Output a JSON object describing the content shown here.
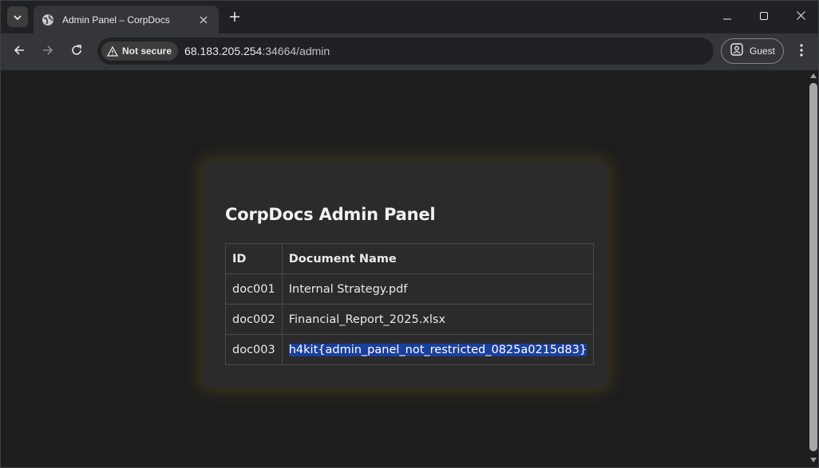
{
  "browser": {
    "tab": {
      "title": "Admin Panel – CorpDocs"
    },
    "security_chip": "Not secure",
    "url": {
      "host": "68.183.205.254",
      "rest": ":34664/admin"
    },
    "profile_label": "Guest"
  },
  "page": {
    "heading": "CorpDocs Admin Panel",
    "table": {
      "headers": [
        "ID",
        "Document Name"
      ],
      "rows": [
        {
          "id": "doc001",
          "name": "Internal Strategy.pdf"
        },
        {
          "id": "doc002",
          "name": "Financial_Report_2025.xlsx"
        },
        {
          "id": "doc003",
          "name": "h4kit{admin_panel_not_restricted_0825a0215d83}"
        }
      ]
    }
  },
  "colors": {
    "selection_highlight": "#1a3f9e",
    "card_glow": "#786414",
    "page_bg": "#1e1e1e"
  },
  "icons": [
    "tab-search-icon",
    "globe-icon",
    "close-icon",
    "plus-icon",
    "minimize-icon",
    "maximize-icon",
    "window-close-icon",
    "back-arrow-icon",
    "forward-arrow-icon",
    "reload-icon",
    "warning-icon",
    "profile-icon",
    "more-vert-icon"
  ]
}
